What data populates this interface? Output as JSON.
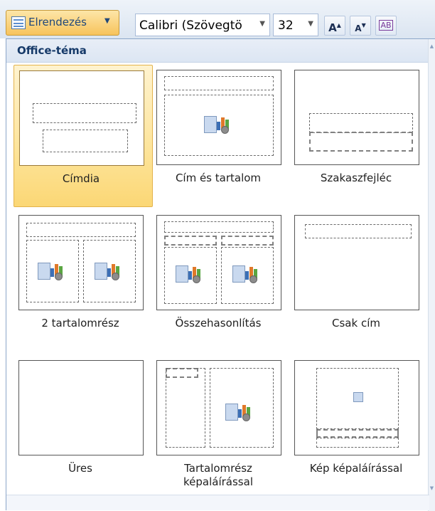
{
  "ribbon": {
    "layout_button_label": "Elrendezés",
    "font_name": "Calibri (Szövegtö",
    "font_size": "32",
    "grow_font_glyph": "A",
    "shrink_font_glyph": "A",
    "clear_format_glyph": "AB"
  },
  "gallery": {
    "header": "Office-téma",
    "selected_index": 0,
    "layouts": [
      {
        "label": "Címdia"
      },
      {
        "label": "Cím és tartalom"
      },
      {
        "label": "Szakaszfejléc"
      },
      {
        "label": "2 tartalomrész"
      },
      {
        "label": "Összehasonlítás"
      },
      {
        "label": "Csak cím"
      },
      {
        "label": "Üres"
      },
      {
        "label_line1": "Tartalomrész",
        "label_line2": "képaláírással"
      },
      {
        "label": "Kép képaláírással"
      }
    ]
  },
  "colors": {
    "selected_tile": "#fde49a",
    "header_text": "#163a69",
    "ribbon_bg": "#dbe5f1"
  },
  "icons": [
    "layout-icon",
    "dropdown-caret-icon",
    "grow-font-icon",
    "shrink-font-icon",
    "clear-format-icon",
    "content-placeholder-icon",
    "scroll-up-icon",
    "scroll-down-icon"
  ]
}
